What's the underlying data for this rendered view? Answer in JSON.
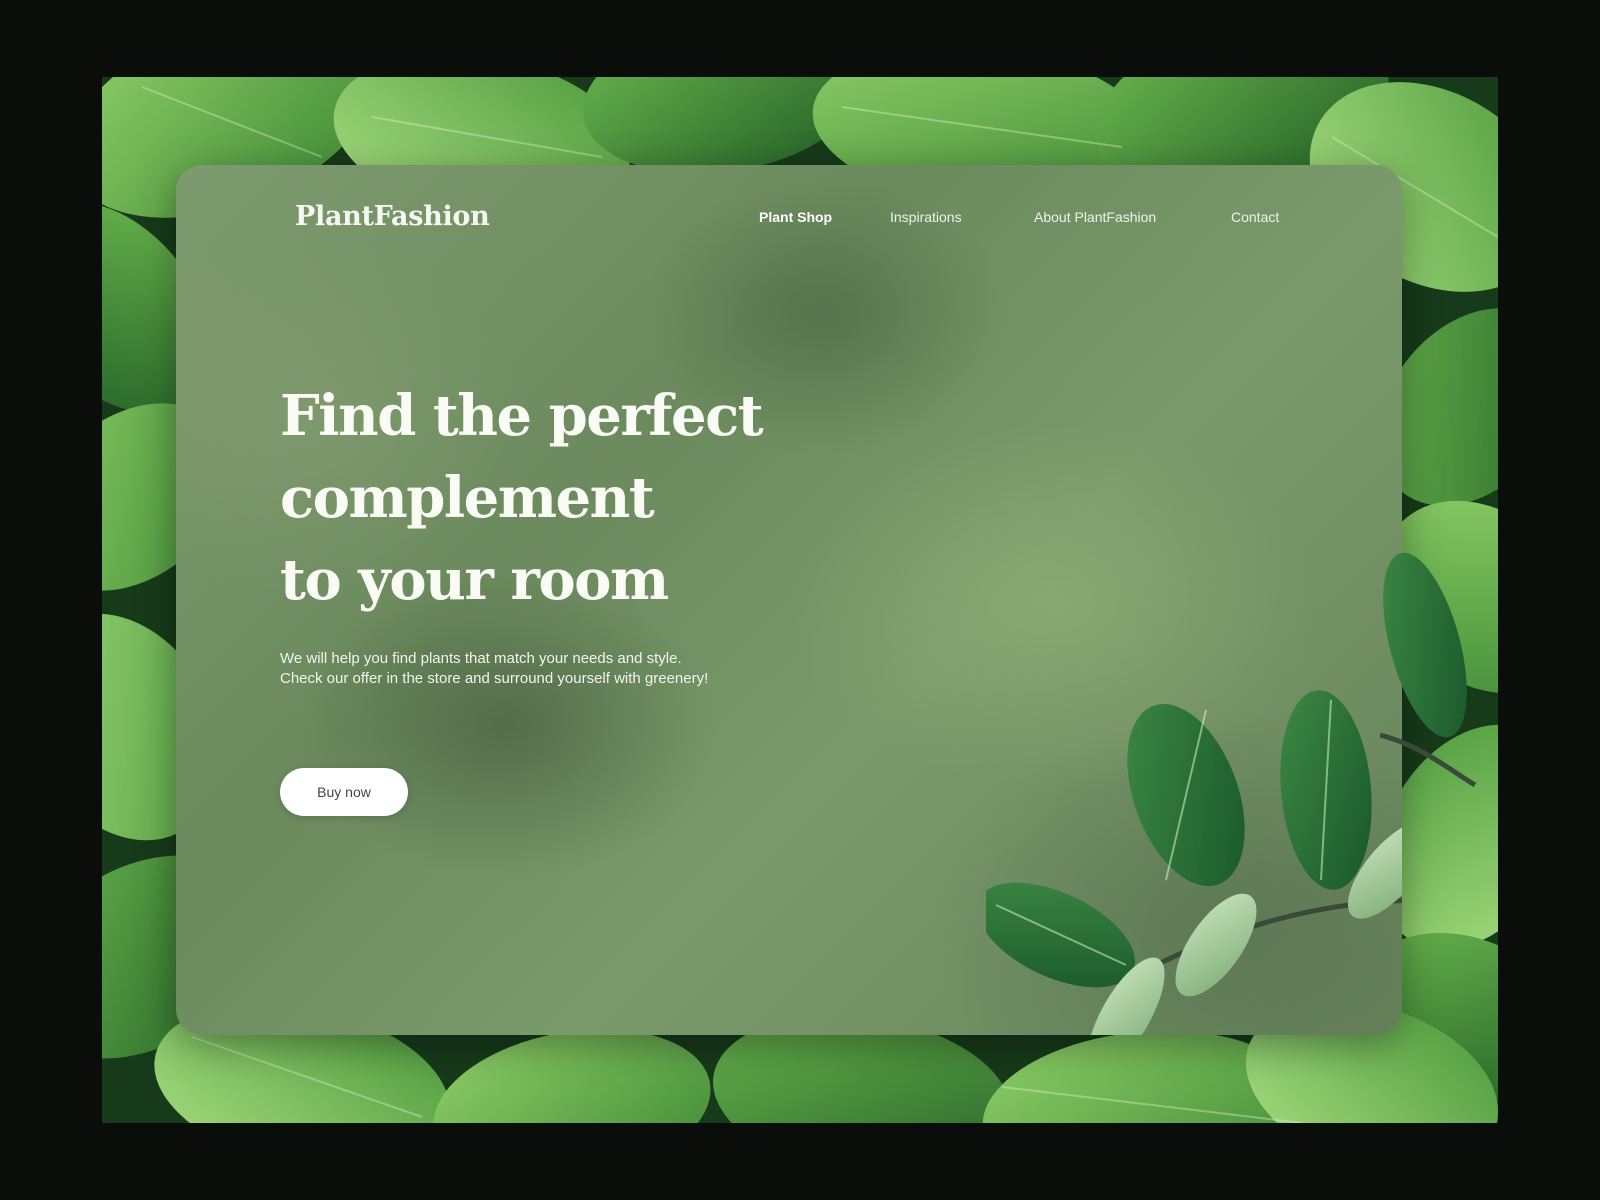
{
  "brand": {
    "name": "PlantFashion"
  },
  "nav": {
    "items": [
      {
        "label": "Plant Shop",
        "active": true
      },
      {
        "label": "Inspirations",
        "active": false
      },
      {
        "label": "About PlantFashion",
        "active": false
      },
      {
        "label": "Contact",
        "active": false
      }
    ]
  },
  "hero": {
    "title_lines": [
      "Find the perfect",
      "complement",
      "to your room"
    ],
    "subtitle_lines": [
      "We will help you find plants that match your needs and style.",
      "Check our offer in the store and surround yourself with greenery!"
    ],
    "cta_label": "Buy now"
  },
  "colors": {
    "page_background": "#0b0d0b",
    "card_tint": "#7a9a6b",
    "text_light": "#fbfbf6",
    "button_bg": "#ffffff",
    "button_text": "#3c4a3a"
  },
  "icons": {
    "background": "leaves-photo",
    "decoration": "plant-branch-image"
  }
}
